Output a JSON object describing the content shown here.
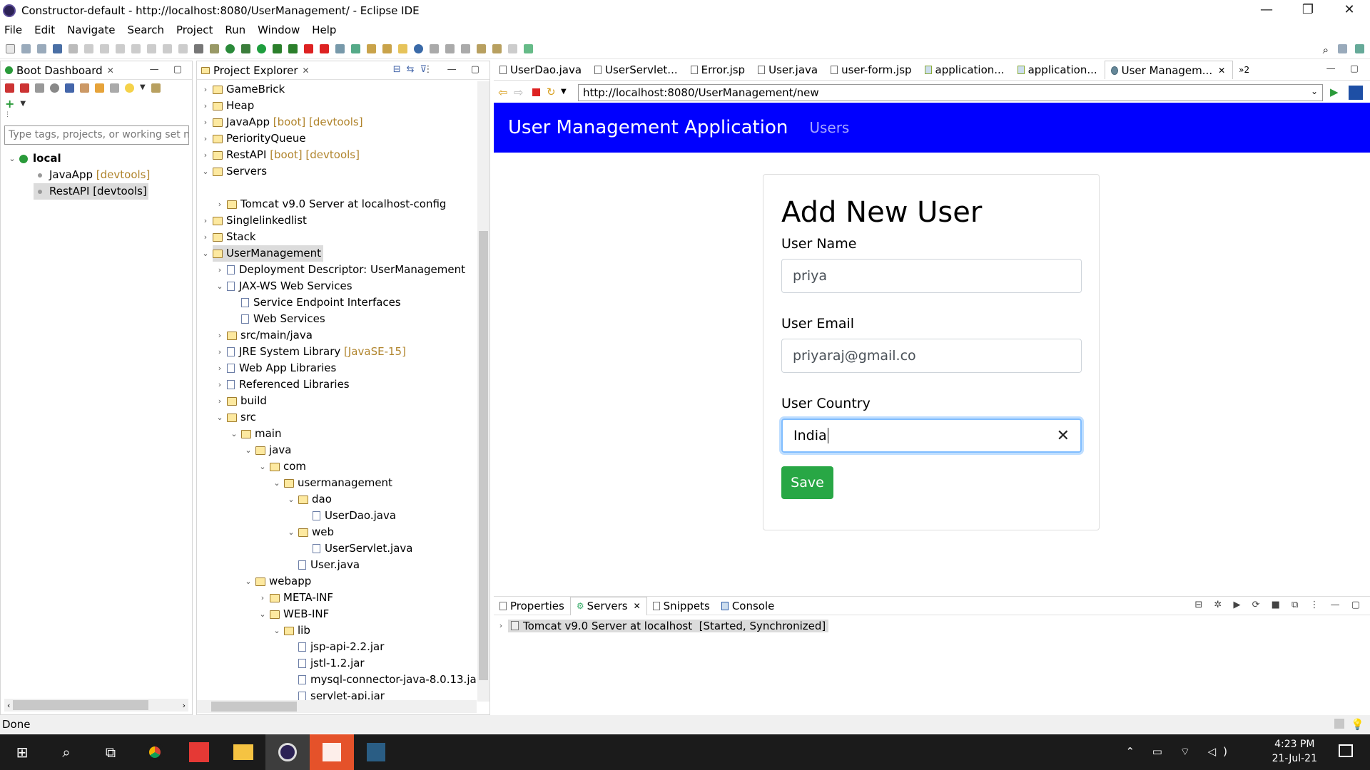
{
  "window": {
    "title": "Constructor-default - http://localhost:8080/UserManagement/ - Eclipse IDE",
    "controls": [
      "—",
      "❐",
      "✕"
    ]
  },
  "menu": [
    "File",
    "Edit",
    "Navigate",
    "Search",
    "Project",
    "Run",
    "Window",
    "Help"
  ],
  "boot_dashboard": {
    "tab": "Boot Dashboard",
    "filter_placeholder": "Type tags, projects, or working set names to match",
    "local_label": "local",
    "apps": [
      {
        "name": "JavaApp",
        "tag": "[devtools]"
      },
      {
        "name": "RestAPI",
        "tag": "[devtools]"
      }
    ]
  },
  "project_explorer": {
    "tab": "Project Explorer",
    "items": [
      {
        "label": "GameBrick",
        "deco": ""
      },
      {
        "label": "Heap",
        "deco": ""
      },
      {
        "label": "JavaApp",
        "deco": "[boot] [devtools]"
      },
      {
        "label": "PeriorityQueue",
        "deco": ""
      },
      {
        "label": "RestAPI",
        "deco": "[boot] [devtools]"
      },
      {
        "label": "Servers",
        "deco": ""
      },
      {
        "label": "Tomcat v9.0 Server at localhost-config",
        "deco": ""
      },
      {
        "label": "Singlelinkedlist",
        "deco": ""
      },
      {
        "label": "Stack",
        "deco": ""
      },
      {
        "label": "UserManagement",
        "deco": ""
      },
      {
        "label": "Deployment Descriptor: UserManagement",
        "deco": ""
      },
      {
        "label": "JAX-WS Web Services",
        "deco": ""
      },
      {
        "label": "Service Endpoint Interfaces",
        "deco": ""
      },
      {
        "label": "Web Services",
        "deco": ""
      },
      {
        "label": "src/main/java",
        "deco": ""
      },
      {
        "label": "JRE System Library",
        "deco": "[JavaSE-15]"
      },
      {
        "label": "Web App Libraries",
        "deco": ""
      },
      {
        "label": "Referenced Libraries",
        "deco": ""
      },
      {
        "label": "build",
        "deco": ""
      },
      {
        "label": "src",
        "deco": ""
      },
      {
        "label": "main",
        "deco": ""
      },
      {
        "label": "java",
        "deco": ""
      },
      {
        "label": "com",
        "deco": ""
      },
      {
        "label": "usermanagement",
        "deco": ""
      },
      {
        "label": "dao",
        "deco": ""
      },
      {
        "label": "UserDao.java",
        "deco": ""
      },
      {
        "label": "web",
        "deco": ""
      },
      {
        "label": "UserServlet.java",
        "deco": ""
      },
      {
        "label": "User.java",
        "deco": ""
      },
      {
        "label": "webapp",
        "deco": ""
      },
      {
        "label": "META-INF",
        "deco": ""
      },
      {
        "label": "WEB-INF",
        "deco": ""
      },
      {
        "label": "lib",
        "deco": ""
      },
      {
        "label": "jsp-api-2.2.jar",
        "deco": ""
      },
      {
        "label": "jstl-1.2.jar",
        "deco": ""
      },
      {
        "label": "mysql-connector-java-8.0.13.jar",
        "deco": ""
      },
      {
        "label": "servlet-api.jar",
        "deco": ""
      }
    ]
  },
  "editor_tabs": [
    "UserDao.java",
    "UserServlet...",
    "Error.jsp",
    "User.java",
    "user-form.jsp",
    "application...",
    "application...",
    "User Managem..."
  ],
  "editor_overflow": "»2",
  "browser": {
    "url": "http://localhost:8080/UserManagement/new"
  },
  "webapp": {
    "brand": "User Management Application",
    "nav_users": "Users",
    "form_title": "Add New User",
    "name_label": "User Name",
    "name_value": "priya",
    "email_label": "User Email",
    "email_value": "priyaraj@gmail.co",
    "country_label": "User Country",
    "country_value": "India",
    "save_label": "Save"
  },
  "bottom_tabs": [
    "Properties",
    "Servers",
    "Snippets",
    "Console"
  ],
  "servers_row": "Tomcat v9.0 Server at localhost  [Started, Synchronized]",
  "status": "Done",
  "clock": {
    "time": "4:23 PM",
    "date": "21-Jul-21"
  },
  "colors": {
    "nav": "#0000ff",
    "save": "#28a745",
    "focus": "#80bdff"
  }
}
